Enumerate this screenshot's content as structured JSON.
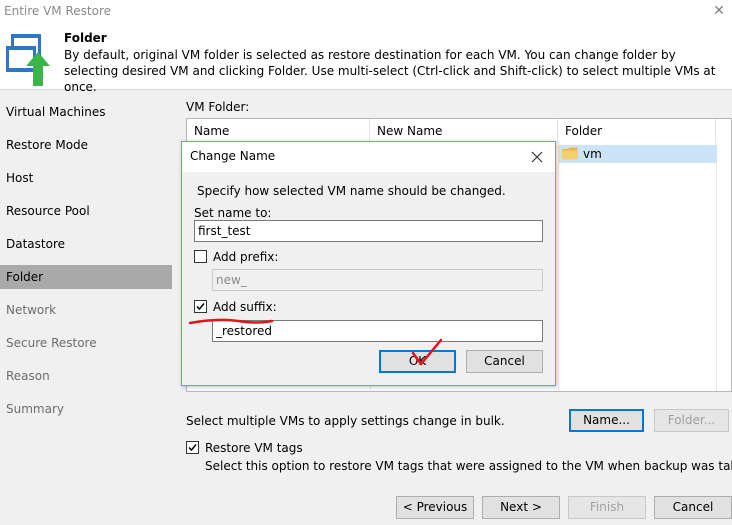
{
  "window": {
    "title": "Entire VM Restore"
  },
  "header": {
    "title": "Folder",
    "description": "By default, original VM folder is selected as restore destination for each VM. You can change folder by selecting desired VM and clicking Folder. Use multi-select (Ctrl-click and Shift-click) to select multiple VMs at once."
  },
  "sidebar": {
    "items": [
      {
        "label": "Virtual Machines"
      },
      {
        "label": "Restore Mode"
      },
      {
        "label": "Host"
      },
      {
        "label": "Resource Pool"
      },
      {
        "label": "Datastore"
      },
      {
        "label": "Folder"
      },
      {
        "label": "Network"
      },
      {
        "label": "Secure Restore"
      },
      {
        "label": "Reason"
      },
      {
        "label": "Summary"
      }
    ]
  },
  "main": {
    "vm_folder_label": "VM Folder:",
    "table": {
      "columns": [
        "Name",
        "New Name",
        "Folder"
      ],
      "rows": [
        {
          "folder": "vm"
        }
      ]
    },
    "bulk_hint": "Select multiple VMs to apply settings change in bulk.",
    "name_button": "Name...",
    "folder_button": "Folder...",
    "restore_tags": {
      "label": "Restore VM tags",
      "checked": true,
      "hint": "Select this option to restore VM tags that were assigned to the VM when backup was taken."
    }
  },
  "dialog": {
    "title": "Change Name",
    "instruction": "Specify how selected VM name should be changed.",
    "set_name_label": "Set name to:",
    "set_name_value": "first_test",
    "add_prefix_label": "Add prefix:",
    "add_prefix_checked": false,
    "prefix_value": "new_",
    "add_suffix_label": "Add suffix:",
    "add_suffix_checked": true,
    "suffix_value": "_restored",
    "ok_label": "OK",
    "cancel_label": "Cancel"
  },
  "footer": {
    "previous": "< Previous",
    "next": "Next >",
    "finish": "Finish",
    "cancel": "Cancel"
  },
  "colors": {
    "selection": "#cce4f7",
    "active_nav": "#a9a9a9",
    "annotation": "#e8101a",
    "focus_border": "#0078d7"
  }
}
